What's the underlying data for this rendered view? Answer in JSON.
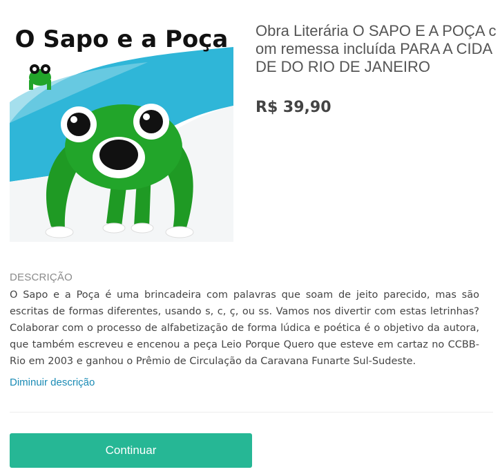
{
  "product": {
    "image_caption": "O Sapo e a Poça",
    "title": "Obra Literária O SAPO E A POÇA com remessa incluída PARA A CIDADE DO RIO DE JANEIRO",
    "price": "R$ 39,90"
  },
  "description": {
    "heading": "DESCRIÇÃO",
    "text": "O Sapo e a Poça é uma brincadeira com palavras que soam de jeito parecido, mas são escritas de formas diferentes, usando s, c, ç, ou ss. Vamos nos divertir com estas letrinhas? Colaborar com o processo de alfabetização de forma lúdica e poética é o objetivo da autora, que também escreveu e encenou a peça Leio Porque Quero que esteve em cartaz no CCBB-Rio em 2003 e ganhou o Prêmio de Circulação da Caravana Funarte Sul-Sudeste.",
    "toggle_label": "Diminuir descrição"
  },
  "actions": {
    "continue_label": "Continuar"
  },
  "colors": {
    "button": "#26b795",
    "link": "#1a8bb5",
    "frog_green": "#22a52a"
  }
}
